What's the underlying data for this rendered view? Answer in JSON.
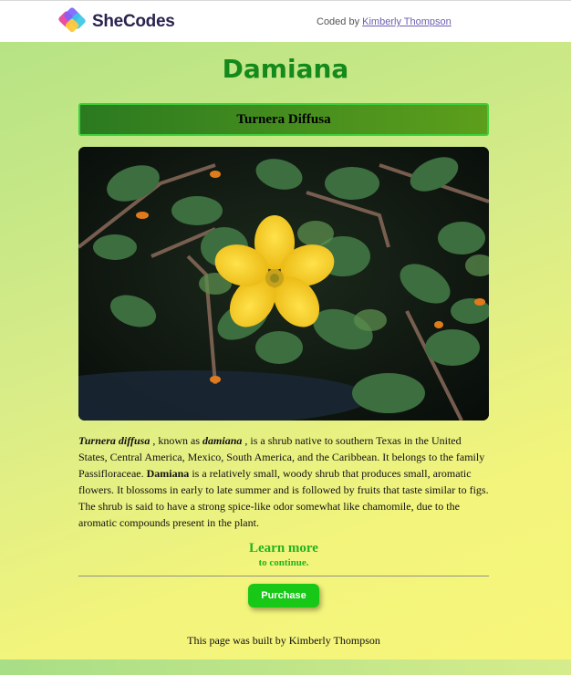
{
  "header": {
    "brand": "SheCodes",
    "coded_by_prefix": "Coded by",
    "coded_by_name": "Kimberly Thompson",
    "logo_colors": [
      "#e84fa0",
      "#7b61ff",
      "#36c6e6",
      "#ffc93c"
    ]
  },
  "main": {
    "title": "Damiana",
    "subtitle": "Turnera Diffusa",
    "image_icon": "damiana-flower-photo",
    "description": {
      "p1_italic": "Turnera diffusa",
      "p2": " , known as ",
      "p3_italic": "damiana",
      "p4": " , is a shrub native to southern Texas in the United States, Central America, Mexico, South America, and the Caribbean. It belongs to the family Passifloraceae. ",
      "p5_bold": "Damiana",
      "p6": " is a relatively small, woody shrub that produces small, aromatic flowers. It blossoms in early to late summer and is followed by fruits that taste similar to figs. The shrub is said to have a strong spice-like odor somewhat like chamomile, due to the aromatic compounds present in the plant."
    },
    "learn_more": "Learn more",
    "continue_text": "to continue.",
    "purchase_label": "Purchase"
  },
  "footer": {
    "text": "This page was built by Kimberly Thompson"
  },
  "colors": {
    "title": "#148a1c",
    "link_green": "#22b41e",
    "button": "#17c817",
    "subtitle_border": "#3bd23b"
  }
}
